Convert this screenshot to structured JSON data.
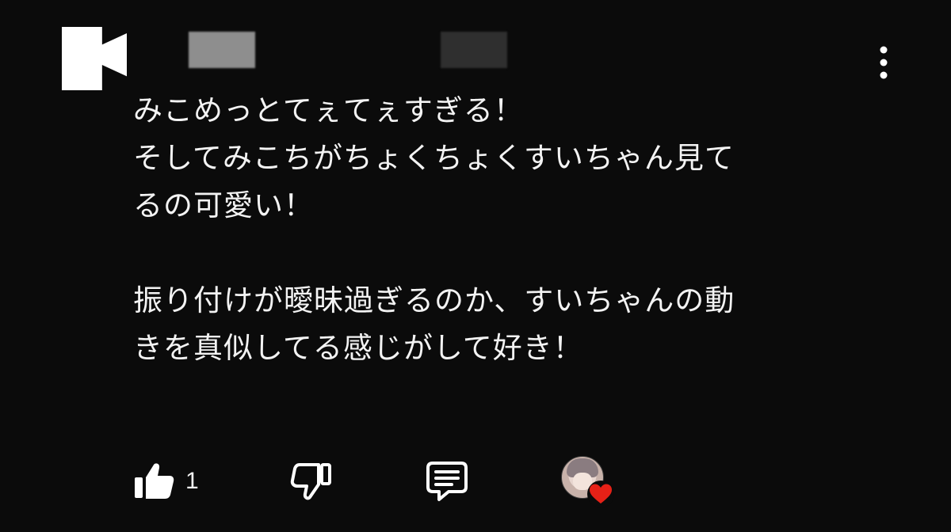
{
  "comment": {
    "text_lines": [
      "みこめっとてぇてぇすぎる！",
      "そしてみこちがちょくちょくすいちゃん見て",
      "るの可愛い！",
      "",
      "振り付けが曖昧過ぎるのか、すいちゃんの動",
      "きを真似してる感じがして好き！"
    ],
    "text": "みこめっとてぇてぇすぎる！\nそしてみこちがちょくちょくすいちゃん見て\nるの可愛い！\n\n振り付けが曖昧過ぎるのか、すいちゃんの動\nきを真似してる感じがして好き！",
    "like_count": "1",
    "icons": {
      "like": "thumbs-up-icon",
      "dislike": "thumbs-down-icon",
      "reply": "comment-icon",
      "more": "more-vert-icon",
      "creator_heart": "heart-icon"
    },
    "colors": {
      "background": "#0b0b0b",
      "text": "#f3f3f3",
      "heart": "#e62117"
    }
  }
}
